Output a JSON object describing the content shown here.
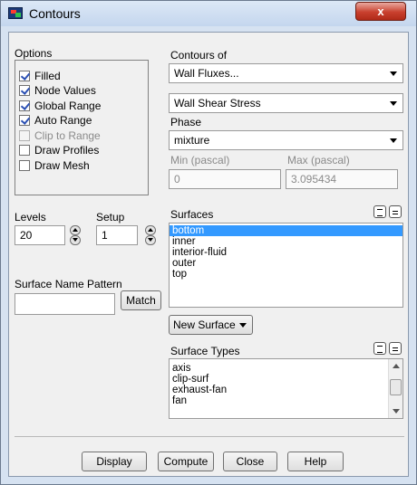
{
  "window": {
    "title": "Contours",
    "close_label": "x"
  },
  "options": {
    "label": "Options",
    "items": [
      {
        "label": "Filled",
        "checked": true,
        "enabled": true
      },
      {
        "label": "Node Values",
        "checked": true,
        "enabled": true
      },
      {
        "label": "Global Range",
        "checked": true,
        "enabled": true
      },
      {
        "label": "Auto Range",
        "checked": true,
        "enabled": true
      },
      {
        "label": "Clip to Range",
        "checked": false,
        "enabled": false
      },
      {
        "label": "Draw Profiles",
        "checked": false,
        "enabled": true
      },
      {
        "label": "Draw Mesh",
        "checked": false,
        "enabled": true
      }
    ]
  },
  "contours_of": {
    "label": "Contours of",
    "category": "Wall Fluxes...",
    "quantity": "Wall Shear Stress"
  },
  "phase": {
    "label": "Phase",
    "value": "mixture"
  },
  "range": {
    "min_label": "Min (pascal)",
    "min_value": "0",
    "max_label": "Max (pascal)",
    "max_value": "3.095434"
  },
  "levels": {
    "label": "Levels",
    "value": "20"
  },
  "setup": {
    "label": "Setup",
    "value": "1"
  },
  "surfaces": {
    "label": "Surfaces",
    "items": [
      "bottom",
      "inner",
      "interior-fluid",
      "outer",
      "top"
    ],
    "selected": "bottom"
  },
  "surface_name_pattern": {
    "label": "Surface Name Pattern",
    "value": "",
    "match_label": "Match"
  },
  "new_surface": {
    "label": "New Surface"
  },
  "surface_types": {
    "label": "Surface Types",
    "items": [
      "axis",
      "clip-surf",
      "exhaust-fan",
      "fan"
    ]
  },
  "footer": {
    "display": "Display",
    "compute": "Compute",
    "close": "Close",
    "help": "Help"
  }
}
